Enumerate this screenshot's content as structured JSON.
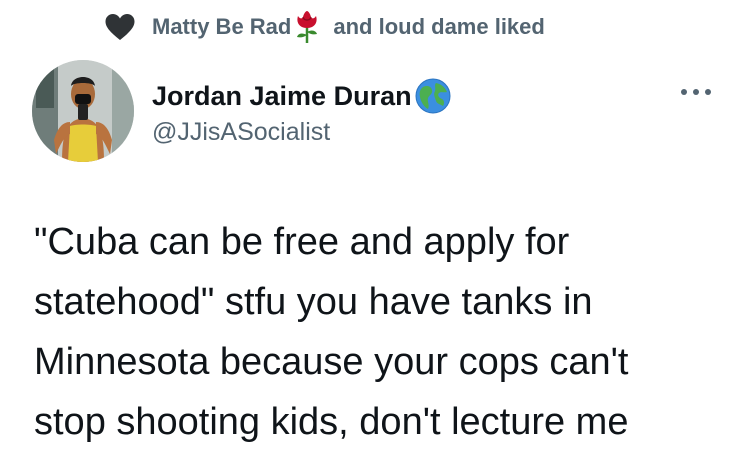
{
  "social_context": {
    "icon": "heart-icon",
    "liker_one": "Matty Be Rad",
    "liker_one_emoji": "rose-icon",
    "rest": "and loud dame liked"
  },
  "tweet": {
    "author": {
      "display_name": "Jordan Jaime Duran",
      "name_emoji": "globe-icon",
      "handle": "@JJisASocialist"
    },
    "more_icon": "more-icon",
    "text_lines": [
      "\"Cuba can be free and apply for",
      "statehood\" stfu you have tanks in",
      "Minnesota because your cops can't",
      "stop shooting kids, don't lecture me"
    ]
  },
  "colors": {
    "text_primary": "#0f1419",
    "text_secondary": "#536471",
    "heart": "#2f3336",
    "background": "#ffffff"
  }
}
